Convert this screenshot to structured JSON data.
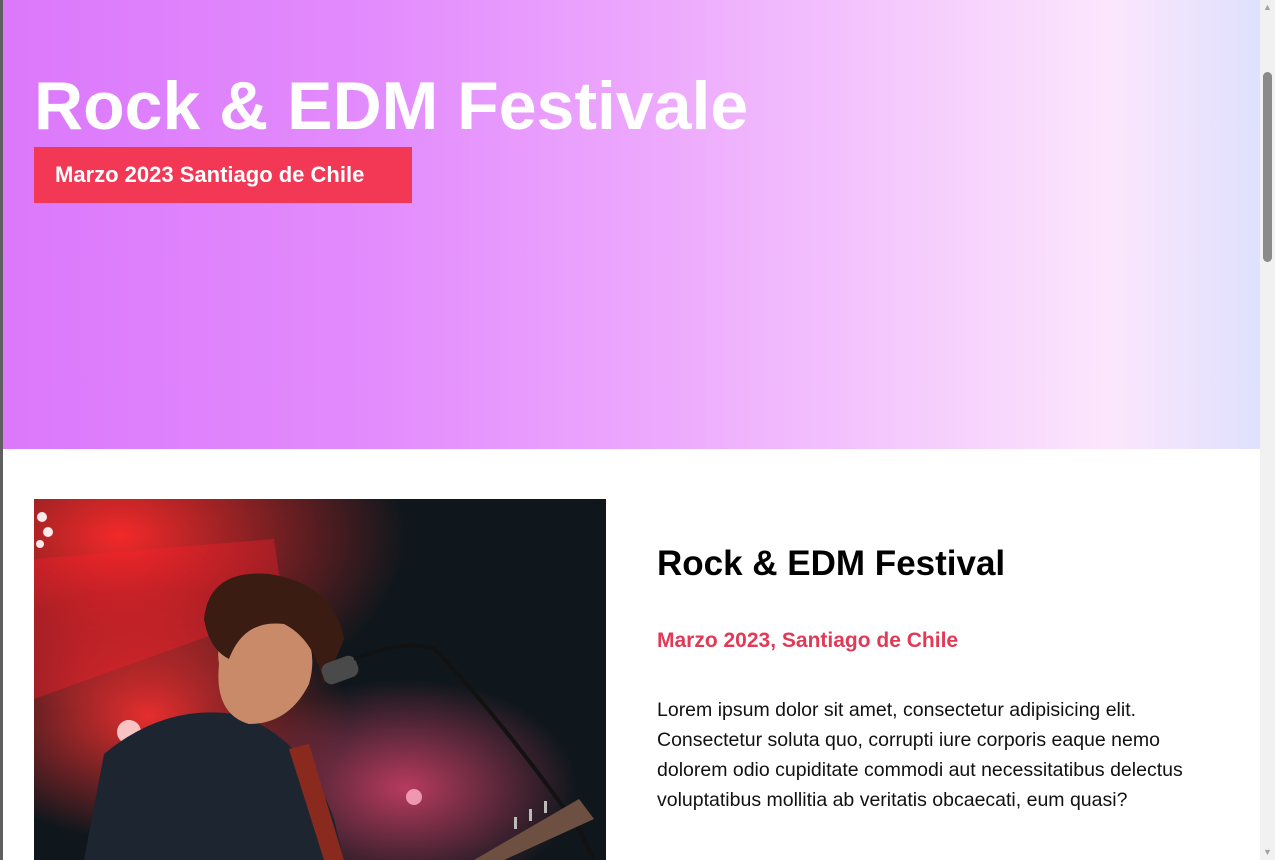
{
  "hero": {
    "title": "Rock & EDM Festivale",
    "badge": "Marzo 2023 Santiago de Chile"
  },
  "feature": {
    "image_icon": "concert-photo",
    "title": "Rock & EDM Festival",
    "date": "Marzo 2023, Santiago de Chile",
    "description": "Lorem ipsum dolor sit amet, consectetur adipisicing elit. Consectetur soluta quo, corrupti iure corporis eaque nemo dolorem odio cupiditate commodi aut necessitatibus delectus voluptatibus mollitia ab veritatis obcaecati, eum quasi?"
  },
  "colors": {
    "accent": "#f33855",
    "date_text": "#e03a56",
    "hero_gradient_start": "#db78fb",
    "hero_gradient_end": "#dfe1fd"
  },
  "scrollbar": {
    "up_icon": "arrow-up-icon",
    "down_icon": "arrow-down-icon"
  }
}
